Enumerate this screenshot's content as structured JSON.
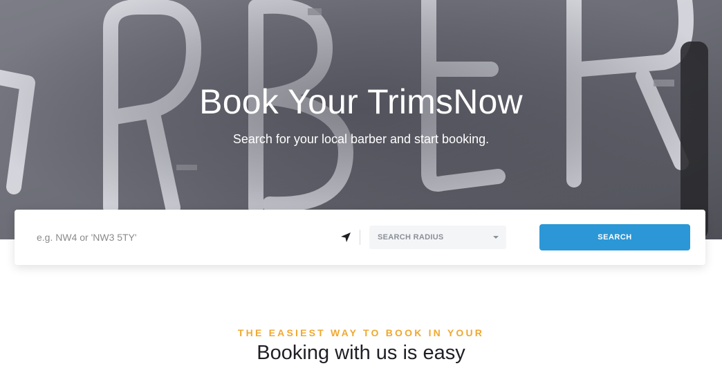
{
  "hero": {
    "title": "Book Your TrimsNow",
    "subtitle": "Search for your local barber and start booking."
  },
  "search": {
    "placeholder": "e.g. NW4 or 'NW3 5TY'",
    "locate_icon": "navigation-arrow-icon",
    "radius_label": "SEARCH RADIUS",
    "button_label": "SEARCH",
    "button_color": "#2b97d6"
  },
  "section": {
    "eyebrow": "THE EASIEST WAY TO BOOK IN YOUR",
    "eyebrow_color": "#f0a830",
    "title": "Booking with us is easy"
  }
}
